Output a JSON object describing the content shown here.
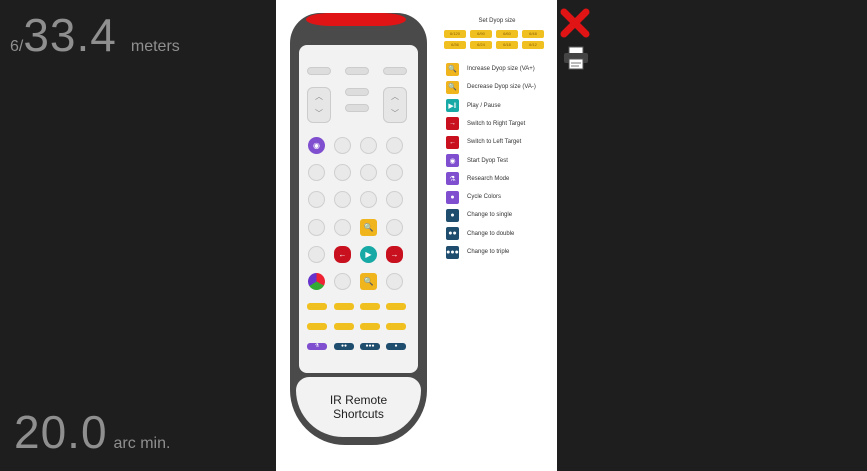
{
  "hud": {
    "top_prefix": "6/",
    "top_value": "33.4",
    "top_unit": "meters",
    "bottom_value": "20.0",
    "bottom_unit": "arc min."
  },
  "remote": {
    "label_line1": "IR Remote",
    "label_line2": "Shortcuts"
  },
  "legend": {
    "title": "Set Dyop size",
    "sizes": [
      "6/120",
      "6/90",
      "6/60",
      "6/48",
      "6/36",
      "6/24",
      "6/18",
      "6/12"
    ],
    "items": [
      {
        "label": "Increase Dyop size (VA+)",
        "icon": "zoom-in-icon",
        "color": "#f0b51c",
        "glyph": "🔍"
      },
      {
        "label": "Decrease Dyop size (VA-)",
        "icon": "zoom-out-icon",
        "color": "#f0b51c",
        "glyph": "🔍"
      },
      {
        "label": "Play / Pause",
        "icon": "play-pause-icon",
        "color": "#17a9a5",
        "glyph": "▶‖"
      },
      {
        "label": "Switch to Right Target",
        "icon": "right-target-icon",
        "color": "#c8101e",
        "glyph": "→"
      },
      {
        "label": "Switch to Left Target",
        "icon": "left-target-icon",
        "color": "#c8101e",
        "glyph": "←"
      },
      {
        "label": "Start Dyop Test",
        "icon": "start-test-icon",
        "color": "#7f4fd0",
        "glyph": "◉"
      },
      {
        "label": "Research Mode",
        "icon": "research-mode-icon",
        "color": "#7f4fd0",
        "glyph": "⚗"
      },
      {
        "label": "Cycle Colors",
        "icon": "cycle-colors-icon",
        "color": "#7f4fd0",
        "glyph": "●"
      },
      {
        "label": "Change to single",
        "icon": "single-icon",
        "color": "#1e4d6e",
        "glyph": "●"
      },
      {
        "label": "Change to double",
        "icon": "double-icon",
        "color": "#1e4d6e",
        "glyph": "●●"
      },
      {
        "label": "Change to triple",
        "icon": "triple-icon",
        "color": "#1e4d6e",
        "glyph": "●●●"
      }
    ]
  },
  "colors": {
    "background": "#1e1e1e",
    "remote_body": "#4a4a4a",
    "remote_top": "#e01414",
    "yellow": "#f0c020",
    "red": "#c8101e",
    "teal": "#17a9a5",
    "purple": "#7f4fd0",
    "navy": "#1e4d6e",
    "close": "#e01414"
  }
}
